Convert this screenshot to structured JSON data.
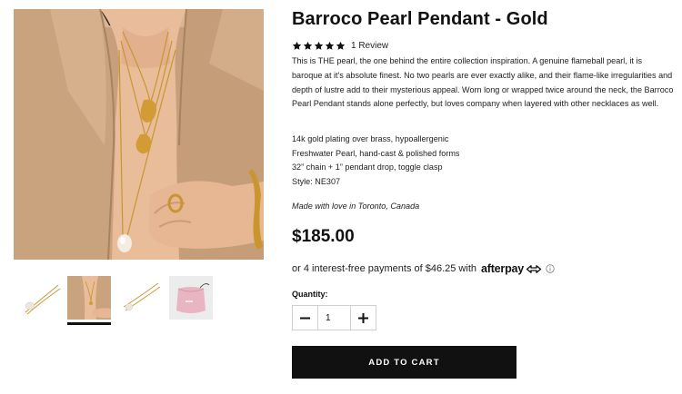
{
  "product": {
    "title": "Barroco Pearl Pendant - Gold",
    "rating": 5,
    "review_count_text": "1 Review",
    "description": "This is THE pearl, the one behind the entire collection inspiration. A genuine flameball pearl, it is baroque at it's absolute finest. No two pearls are ever exactly alike, and their flame-like irregularities and depth of lustre add to their mysterious appeal. Worn long or wrapped twice around the neck, the Barroco Pearl Pendant stands alone perfectly, but loves company when layered with other necklaces as well.",
    "specs": [
      "14k gold plating over brass, hypoallergenic",
      "Freshwater Pearl, hand-cast & polished forms",
      "32” chain + 1” pendant drop, toggle clasp",
      "Style: NE307"
    ],
    "made_in": "Made with love in Toronto, Canada",
    "price": "$185.00"
  },
  "afterpay": {
    "text": "or 4 interest-free payments of $46.25 with",
    "brand": "afterpay"
  },
  "quantity": {
    "label": "Quantity:",
    "value": "1"
  },
  "cart": {
    "button_label": "ADD TO CART"
  },
  "gallery": {
    "active_thumbnail": 2,
    "thumbnails": [
      "pendant-on-white",
      "model-wearing-necklaces",
      "chain-on-white",
      "pink-pouch"
    ]
  },
  "colors": {
    "button_bg": "#111111",
    "star": "#111111",
    "skin": "#e7b794",
    "blazer": "#c9a27e",
    "gold": "#c8952f",
    "pouch": "#e9b5c2"
  }
}
